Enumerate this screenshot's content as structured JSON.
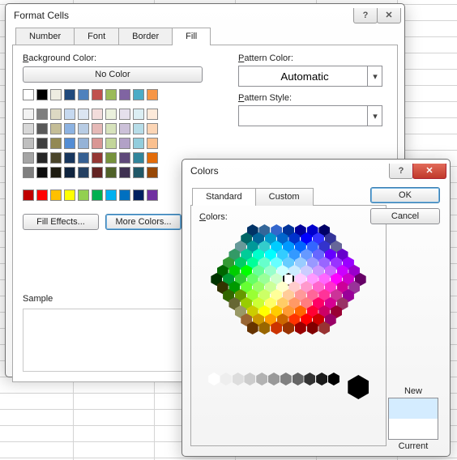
{
  "format_dialog": {
    "title": "Format Cells",
    "tabs": [
      "Number",
      "Font",
      "Border",
      "Fill"
    ],
    "active_tab": "Fill",
    "bg_label": "Background Color:",
    "no_color": "No Color",
    "fill_effects": "Fill Effects...",
    "more_colors": "More Colors...",
    "sample_label": "Sample",
    "pattern_color_label": "Pattern Color:",
    "pattern_color_value": "Automatic",
    "pattern_style_label": "Pattern Style:",
    "pattern_style_value": "",
    "swatch_row1": [
      "#ffffff",
      "#000000",
      "#eeece1",
      "#1f497d",
      "#4f81bd",
      "#c0504d",
      "#9bbb59",
      "#8064a2",
      "#4bacc6",
      "#f79646"
    ],
    "theme_block": [
      [
        "#f2f2f2",
        "#7f7f7f",
        "#ddd9c3",
        "#c6d9f0",
        "#dbe5f1",
        "#f2dcdb",
        "#ebf1dd",
        "#e5e0ec",
        "#dbeef3",
        "#fdeada"
      ],
      [
        "#d8d8d8",
        "#595959",
        "#c4bd97",
        "#8db3e2",
        "#b8cce4",
        "#e5b9b7",
        "#d7e3bc",
        "#ccc1d9",
        "#b7dde8",
        "#fbd5b5"
      ],
      [
        "#bfbfbf",
        "#3f3f3f",
        "#938953",
        "#548dd4",
        "#95b3d7",
        "#d99694",
        "#c3d69b",
        "#b2a1c7",
        "#92cddc",
        "#fac08f"
      ],
      [
        "#a5a5a5",
        "#262626",
        "#494429",
        "#17365d",
        "#366092",
        "#953734",
        "#76923c",
        "#5f497a",
        "#31859b",
        "#e36c09"
      ],
      [
        "#7f7f7f",
        "#0c0c0c",
        "#1d1b10",
        "#0f243e",
        "#244061",
        "#632423",
        "#4f6128",
        "#3f3151",
        "#205867",
        "#974806"
      ]
    ],
    "standard_row": [
      "#c00000",
      "#ff0000",
      "#ffc000",
      "#ffff00",
      "#92d050",
      "#00b050",
      "#00b0f0",
      "#0070c0",
      "#002060",
      "#7030a0"
    ]
  },
  "colors_dialog": {
    "title": "Colors",
    "tabs": [
      "Standard",
      "Custom"
    ],
    "active_tab": "Standard",
    "colors_label": "Colors:",
    "ok": "OK",
    "cancel": "Cancel",
    "new_label": "New",
    "current_label": "Current",
    "new_color": "#d4ecff",
    "current_color": "#ffffff",
    "honeycomb": [
      [
        "#003366",
        "#336699",
        "#3366cc",
        "#003399",
        "#000099",
        "#0000cc",
        "#000066"
      ],
      [
        "#006666",
        "#006699",
        "#0099cc",
        "#0066cc",
        "#0033cc",
        "#0000ff",
        "#3333ff",
        "#333399"
      ],
      [
        "#669999",
        "#009999",
        "#33cccc",
        "#00ccff",
        "#0099ff",
        "#0066ff",
        "#3366ff",
        "#3333cc",
        "#666699"
      ],
      [
        "#339966",
        "#00cc99",
        "#00ffcc",
        "#00ffff",
        "#33ccff",
        "#3399ff",
        "#6699ff",
        "#6666ff",
        "#6600ff",
        "#6600cc"
      ],
      [
        "#339933",
        "#00cc66",
        "#00ff99",
        "#66ffcc",
        "#66ffff",
        "#66ccff",
        "#99ccff",
        "#9999ff",
        "#9966ff",
        "#9933ff",
        "#9900ff"
      ],
      [
        "#006600",
        "#00cc00",
        "#00ff00",
        "#66ff99",
        "#99ffcc",
        "#ccffff",
        "#ccecff",
        "#ccccff",
        "#cc99ff",
        "#cc66ff",
        "#cc00ff",
        "#9900cc"
      ],
      [
        "#003300",
        "#009933",
        "#33cc33",
        "#66ff66",
        "#99ff99",
        "#ccffcc",
        "#ffffff",
        "#ffccff",
        "#ff99ff",
        "#ff66ff",
        "#ff00ff",
        "#cc00cc",
        "#660066"
      ],
      [
        "#333300",
        "#009900",
        "#66ff33",
        "#99ff66",
        "#ccff99",
        "#ffffcc",
        "#ffcccc",
        "#ff99cc",
        "#ff66cc",
        "#ff33cc",
        "#cc0099",
        "#993399"
      ],
      [
        "#336600",
        "#669900",
        "#99ff33",
        "#ccff66",
        "#ffff99",
        "#ffcc99",
        "#ff9999",
        "#ff6699",
        "#ff3399",
        "#cc3399",
        "#990099"
      ],
      [
        "#666633",
        "#99cc00",
        "#ccff33",
        "#ffff66",
        "#ffcc66",
        "#ff9966",
        "#ff7c80",
        "#ff0066",
        "#d60093",
        "#993366"
      ],
      [
        "#999966",
        "#cccc00",
        "#ffff00",
        "#ffcc00",
        "#ff9933",
        "#ff6600",
        "#ff0033",
        "#cc0066",
        "#990033"
      ],
      [
        "#996633",
        "#cc9900",
        "#ff9900",
        "#cc6600",
        "#ff3300",
        "#ff0000",
        "#cc0000",
        "#990066"
      ],
      [
        "#663300",
        "#996600",
        "#cc3300",
        "#993300",
        "#990000",
        "#800000",
        "#993333"
      ]
    ],
    "grays": [
      "#ffffff",
      "#eeeeee",
      "#dddddd",
      "#cccccc",
      "#b2b2b2",
      "#999999",
      "#808080",
      "#666666",
      "#333333",
      "#1a1a1a",
      "#000000"
    ]
  }
}
